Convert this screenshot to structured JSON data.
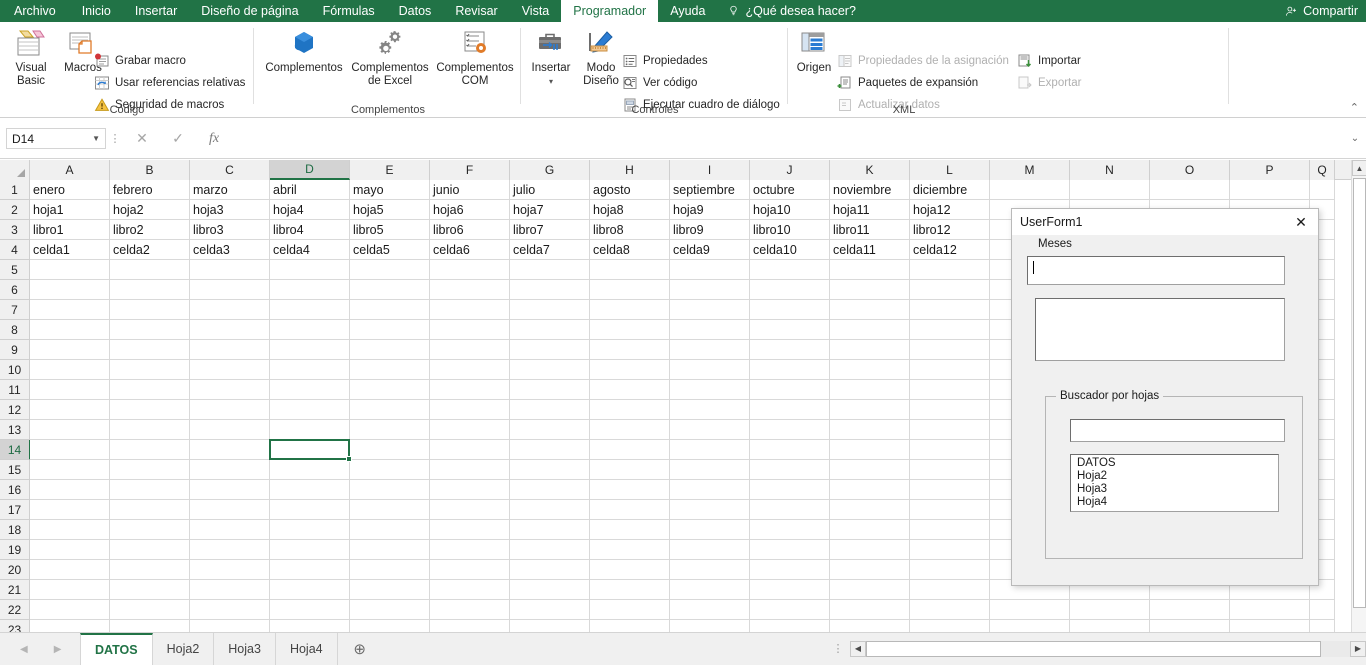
{
  "ribbon": {
    "tabs": [
      {
        "label": "Archivo",
        "active": false
      },
      {
        "label": "Inicio",
        "active": false
      },
      {
        "label": "Insertar",
        "active": false
      },
      {
        "label": "Diseño de página",
        "active": false
      },
      {
        "label": "Fórmulas",
        "active": false
      },
      {
        "label": "Datos",
        "active": false
      },
      {
        "label": "Revisar",
        "active": false
      },
      {
        "label": "Vista",
        "active": false
      },
      {
        "label": "Programador",
        "active": true
      },
      {
        "label": "Ayuda",
        "active": false
      }
    ],
    "tellme": "¿Qué desea hacer?",
    "share": "Compartir",
    "collapse": "⌃",
    "groups": {
      "codigo": {
        "title": "Código",
        "visual_basic": "Visual Basic",
        "macros": "Macros",
        "grabar_macro": "Grabar macro",
        "usar_referencias": "Usar referencias relativas",
        "seguridad": "Seguridad de macros"
      },
      "complementos": {
        "title": "Complementos",
        "complementos": "Complementos",
        "complementos_excel": "Complementos de Excel",
        "complementos_com": "Complementos COM"
      },
      "controles": {
        "title": "Controles",
        "insertar": "Insertar",
        "insertar_caret": "▾",
        "modo_diseno": "Modo Diseño",
        "propiedades": "Propiedades",
        "ver_codigo": "Ver código",
        "ejecutar_dialogo": "Ejecutar cuadro de diálogo"
      },
      "xml": {
        "title": "XML",
        "origen": "Origen",
        "propiedades_asignacion": "Propiedades de la asignación",
        "paquetes_expansion": "Paquetes de expansión",
        "actualizar_datos": "Actualizar datos",
        "importar": "Importar",
        "exportar": "Exportar"
      }
    }
  },
  "formula_bar": {
    "name_box_value": "D14",
    "name_box_caret": "▼",
    "cancel": "✕",
    "confirm": "✓",
    "fx": "fx",
    "formula_value": "",
    "expand": "⌄"
  },
  "grid": {
    "columns": [
      "A",
      "B",
      "C",
      "D",
      "E",
      "F",
      "G",
      "H",
      "I",
      "J",
      "K",
      "L",
      "M",
      "N",
      "O",
      "P",
      "Q"
    ],
    "selected_column": "D",
    "selected_row": "14",
    "rows": [
      "1",
      "2",
      "3",
      "4",
      "5",
      "6",
      "7",
      "8",
      "9",
      "10",
      "11",
      "12",
      "13",
      "14",
      "15",
      "16",
      "17",
      "18",
      "19",
      "20",
      "21",
      "22",
      "23"
    ],
    "data": [
      [
        "enero",
        "febrero",
        "marzo",
        "abril",
        "mayo",
        "junio",
        "julio",
        "agosto",
        "septiembre",
        "octubre",
        "noviembre",
        "diciembre"
      ],
      [
        "hoja1",
        "hoja2",
        "hoja3",
        "hoja4",
        "hoja5",
        "hoja6",
        "hoja7",
        "hoja8",
        "hoja9",
        "hoja10",
        "hoja11",
        "hoja12"
      ],
      [
        "libro1",
        "libro2",
        "libro3",
        "libro4",
        "libro5",
        "libro6",
        "libro7",
        "libro8",
        "libro9",
        "libro10",
        "libro11",
        "libro12"
      ],
      [
        "celda1",
        "celda2",
        "celda3",
        "celda4",
        "celda5",
        "celda6",
        "celda7",
        "celda8",
        "celda9",
        "celda10",
        "celda11",
        "celda12"
      ]
    ],
    "selected_cell": "D14"
  },
  "sheet_tabs": {
    "prev": "◀",
    "next": "▶",
    "tabs": [
      {
        "label": "DATOS",
        "active": true
      },
      {
        "label": "Hoja2",
        "active": false
      },
      {
        "label": "Hoja3",
        "active": false
      },
      {
        "label": "Hoja4",
        "active": false
      }
    ],
    "add": "⊕"
  },
  "scrollbars": {
    "up": "▲",
    "down": "▼",
    "left": "◀",
    "right": "▶"
  },
  "userform": {
    "title": "UserForm1",
    "close": "✕",
    "meses_label": "Meses",
    "meses_textbox_value": "",
    "meses_listbox_items": [],
    "group": {
      "caption": "Buscador por hojas",
      "search_value": "",
      "items": [
        "DATOS",
        "Hoja2",
        "Hoja3",
        "Hoja4"
      ]
    }
  },
  "colors": {
    "brand_green": "#217346",
    "ribbon_bg": "#ffffff",
    "grid_line": "#d9d9d9",
    "header_bg": "#f0f0f0"
  }
}
